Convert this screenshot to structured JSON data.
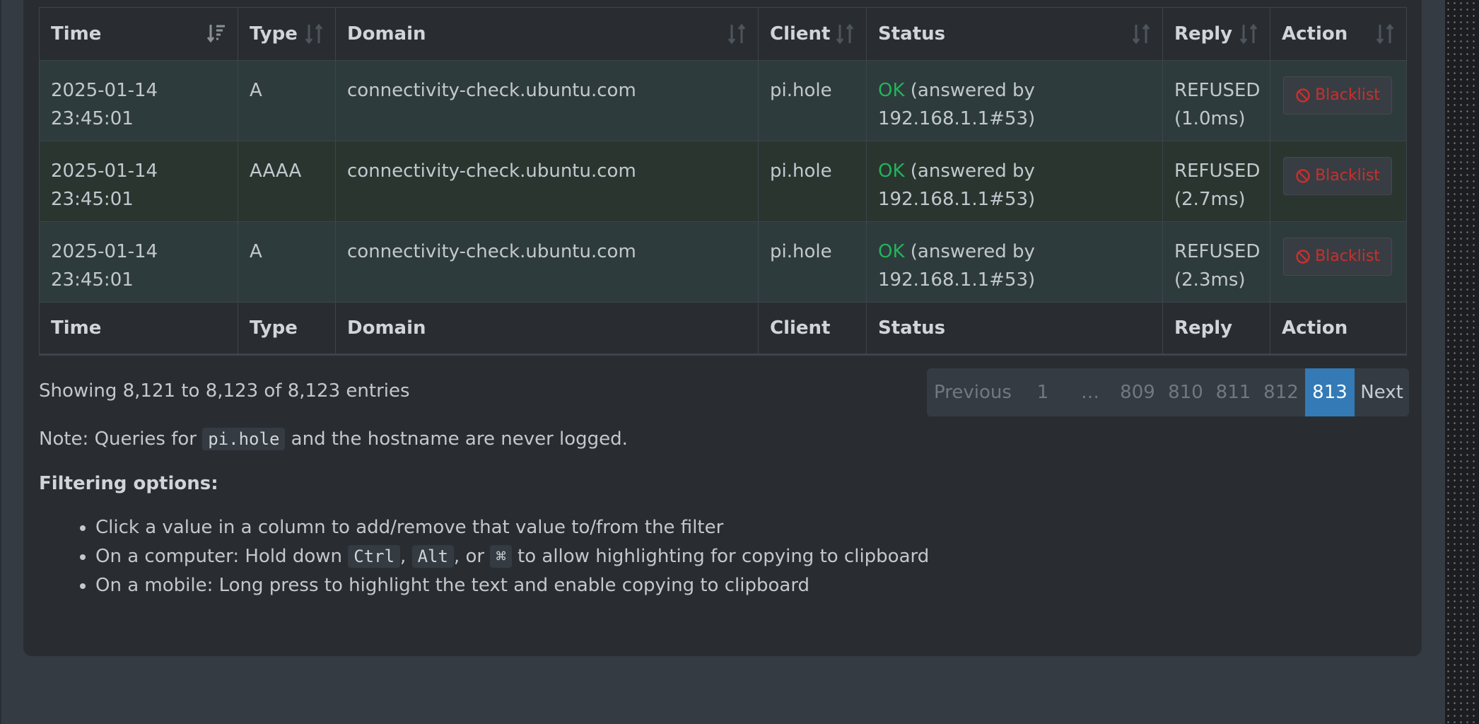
{
  "table": {
    "headers": [
      "Time",
      "Type",
      "Domain",
      "Client",
      "Status",
      "Reply",
      "Action"
    ],
    "rows": [
      {
        "time": "2025-01-14 23:45:01",
        "type": "A",
        "domain": "connectivity-check.ubuntu.com",
        "client": "pi.hole",
        "status_ok": "OK",
        "status_detail": " (answered by 192.168.1.1#53)",
        "reply": "REFUSED",
        "reply_time": "(1.0ms)",
        "action": "Blacklist"
      },
      {
        "time": "2025-01-14 23:45:01",
        "type": "AAAA",
        "domain": "connectivity-check.ubuntu.com",
        "client": "pi.hole",
        "status_ok": "OK",
        "status_detail": " (answered by 192.168.1.1#53)",
        "reply": "REFUSED",
        "reply_time": "(2.7ms)",
        "action": "Blacklist"
      },
      {
        "time": "2025-01-14 23:45:01",
        "type": "A",
        "domain": "connectivity-check.ubuntu.com",
        "client": "pi.hole",
        "status_ok": "OK",
        "status_detail": " (answered by 192.168.1.1#53)",
        "reply": "REFUSED",
        "reply_time": "(2.3ms)",
        "action": "Blacklist"
      }
    ],
    "footer_headers": [
      "Time",
      "Type",
      "Domain",
      "Client",
      "Status",
      "Reply",
      "Action"
    ]
  },
  "info": "Showing 8,121 to 8,123 of 8,123 entries",
  "pagination": {
    "previous": "Previous",
    "pages": [
      "1",
      "…",
      "809",
      "810",
      "811",
      "812",
      "813"
    ],
    "active": "813",
    "next": "Next"
  },
  "note": {
    "before": "Note: Queries for ",
    "code": "pi.hole",
    "after": " and the hostname are never logged."
  },
  "filtering": {
    "title": "Filtering options:",
    "items": {
      "first": "Click a value in a column to add/remove that value to/from the filter",
      "second_a": "On a computer: Hold down ",
      "key_ctrl": "Ctrl",
      "sep1": ", ",
      "key_alt": "Alt",
      "sep2": ", or ",
      "key_cmd": "⌘",
      "second_b": " to allow highlighting for copying to clipboard",
      "third": "On a mobile: Long press to highlight the text and enable copying to clipboard"
    }
  },
  "colors": {
    "ok": "#23b35a",
    "blacklist": "#c9302c",
    "active_page": "#337ab7"
  }
}
